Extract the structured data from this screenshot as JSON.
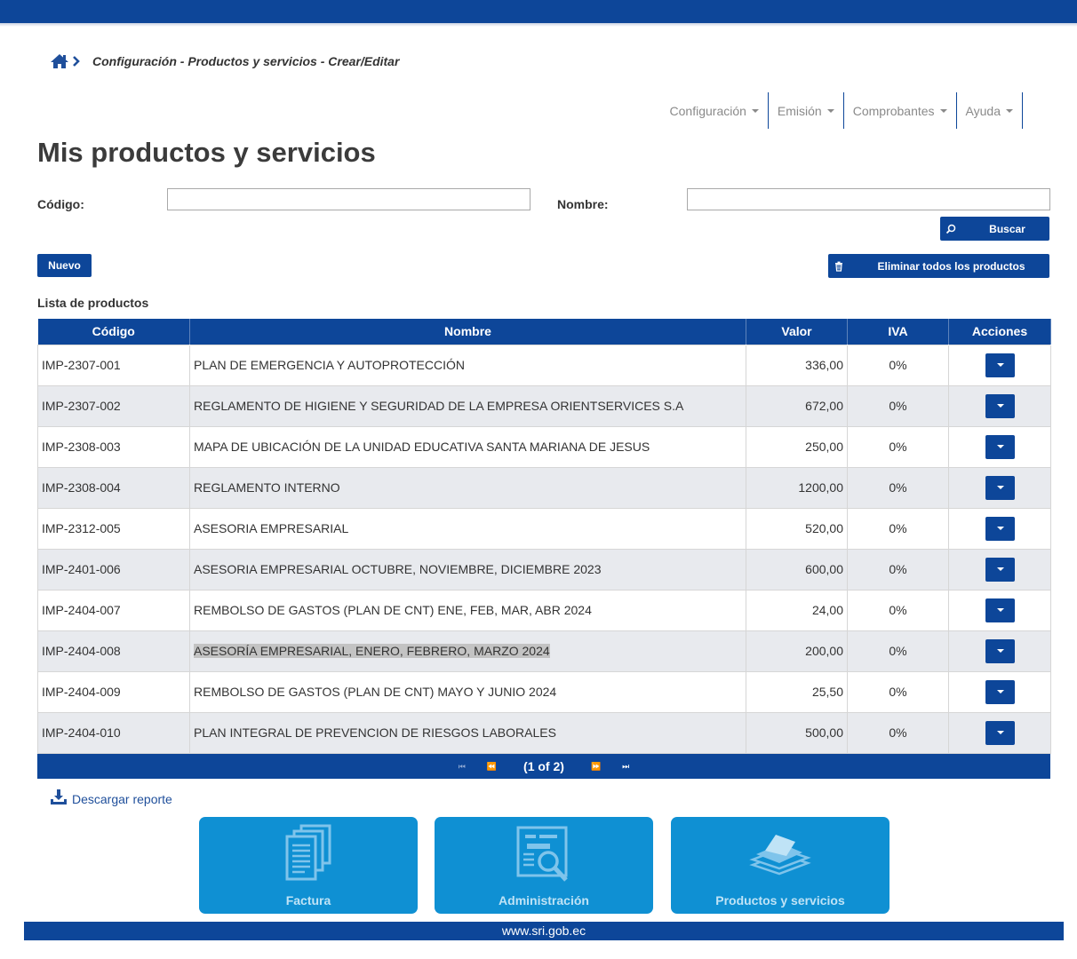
{
  "breadcrumb": {
    "path": "Configuración - Productos y servicios - Crear/Editar"
  },
  "menu": {
    "items": [
      "Configuración",
      "Emisión",
      "Comprobantes",
      "Ayuda"
    ]
  },
  "page": {
    "title": "Mis productos y servicios"
  },
  "filters": {
    "codigo_label": "Código:",
    "codigo_value": "",
    "nombre_label": "Nombre:",
    "nombre_value": ""
  },
  "buttons": {
    "buscar": "Buscar",
    "nuevo": "Nuevo",
    "eliminar": "Eliminar todos los productos"
  },
  "list": {
    "title": "Lista de productos",
    "headers": [
      "Código",
      "Nombre",
      "Valor",
      "IVA",
      "Acciones"
    ],
    "rows": [
      {
        "codigo": "IMP-2307-001",
        "nombre": "PLAN DE EMERGENCIA Y AUTOPROTECCIÓN",
        "valor": "336,00",
        "iva": "0%"
      },
      {
        "codigo": "IMP-2307-002",
        "nombre": "REGLAMENTO DE HIGIENE Y SEGURIDAD DE LA EMPRESA ORIENTSERVICES S.A",
        "valor": "672,00",
        "iva": "0%"
      },
      {
        "codigo": "IMP-2308-003",
        "nombre": "MAPA DE UBICACIÓN DE LA UNIDAD EDUCATIVA SANTA MARIANA DE JESUS",
        "valor": "250,00",
        "iva": "0%"
      },
      {
        "codigo": "IMP-2308-004",
        "nombre": "REGLAMENTO INTERNO",
        "valor": "1200,00",
        "iva": "0%"
      },
      {
        "codigo": "IMP-2312-005",
        "nombre": "ASESORIA EMPRESARIAL",
        "valor": "520,00",
        "iva": "0%"
      },
      {
        "codigo": "IMP-2401-006",
        "nombre": "ASESORIA EMPRESARIAL OCTUBRE, NOVIEMBRE, DICIEMBRE 2023",
        "valor": "600,00",
        "iva": "0%"
      },
      {
        "codigo": "IMP-2404-007",
        "nombre": "REMBOLSO DE GASTOS (PLAN DE CNT) ENE, FEB, MAR, ABR 2024",
        "valor": "24,00",
        "iva": "0%"
      },
      {
        "codigo": "IMP-2404-008",
        "nombre": "ASESORÍA EMPRESARIAL, ENERO, FEBRERO, MARZO 2024",
        "valor": "200,00",
        "iva": "0%",
        "highlighted": true
      },
      {
        "codigo": "IMP-2404-009",
        "nombre": "REMBOLSO DE GASTOS (PLAN DE CNT) MAYO Y JUNIO 2024",
        "valor": "25,50",
        "iva": "0%"
      },
      {
        "codigo": "IMP-2404-010",
        "nombre": "PLAN INTEGRAL DE PREVENCION DE RIESGOS LABORALES",
        "valor": "500,00",
        "iva": "0%"
      }
    ]
  },
  "pager": {
    "info": "(1 of 2)",
    "first_icon": "first-page-icon",
    "prev_icon": "prev-page-icon",
    "next_icon": "next-page-icon",
    "last_icon": "last-page-icon"
  },
  "download": {
    "label": "Descargar reporte"
  },
  "tiles": [
    {
      "label": "Factura",
      "icon": "documents-icon"
    },
    {
      "label": "Administración",
      "icon": "search-document-icon"
    },
    {
      "label": "Productos y servicios",
      "icon": "stacked-papers-icon"
    }
  ],
  "footer": {
    "text": "www.sri.gob.ec"
  },
  "colors": {
    "primary": "#0d4699",
    "tile": "#0f90d3",
    "row_alt": "#e8eaee",
    "highlight": "#c3c3c3"
  }
}
